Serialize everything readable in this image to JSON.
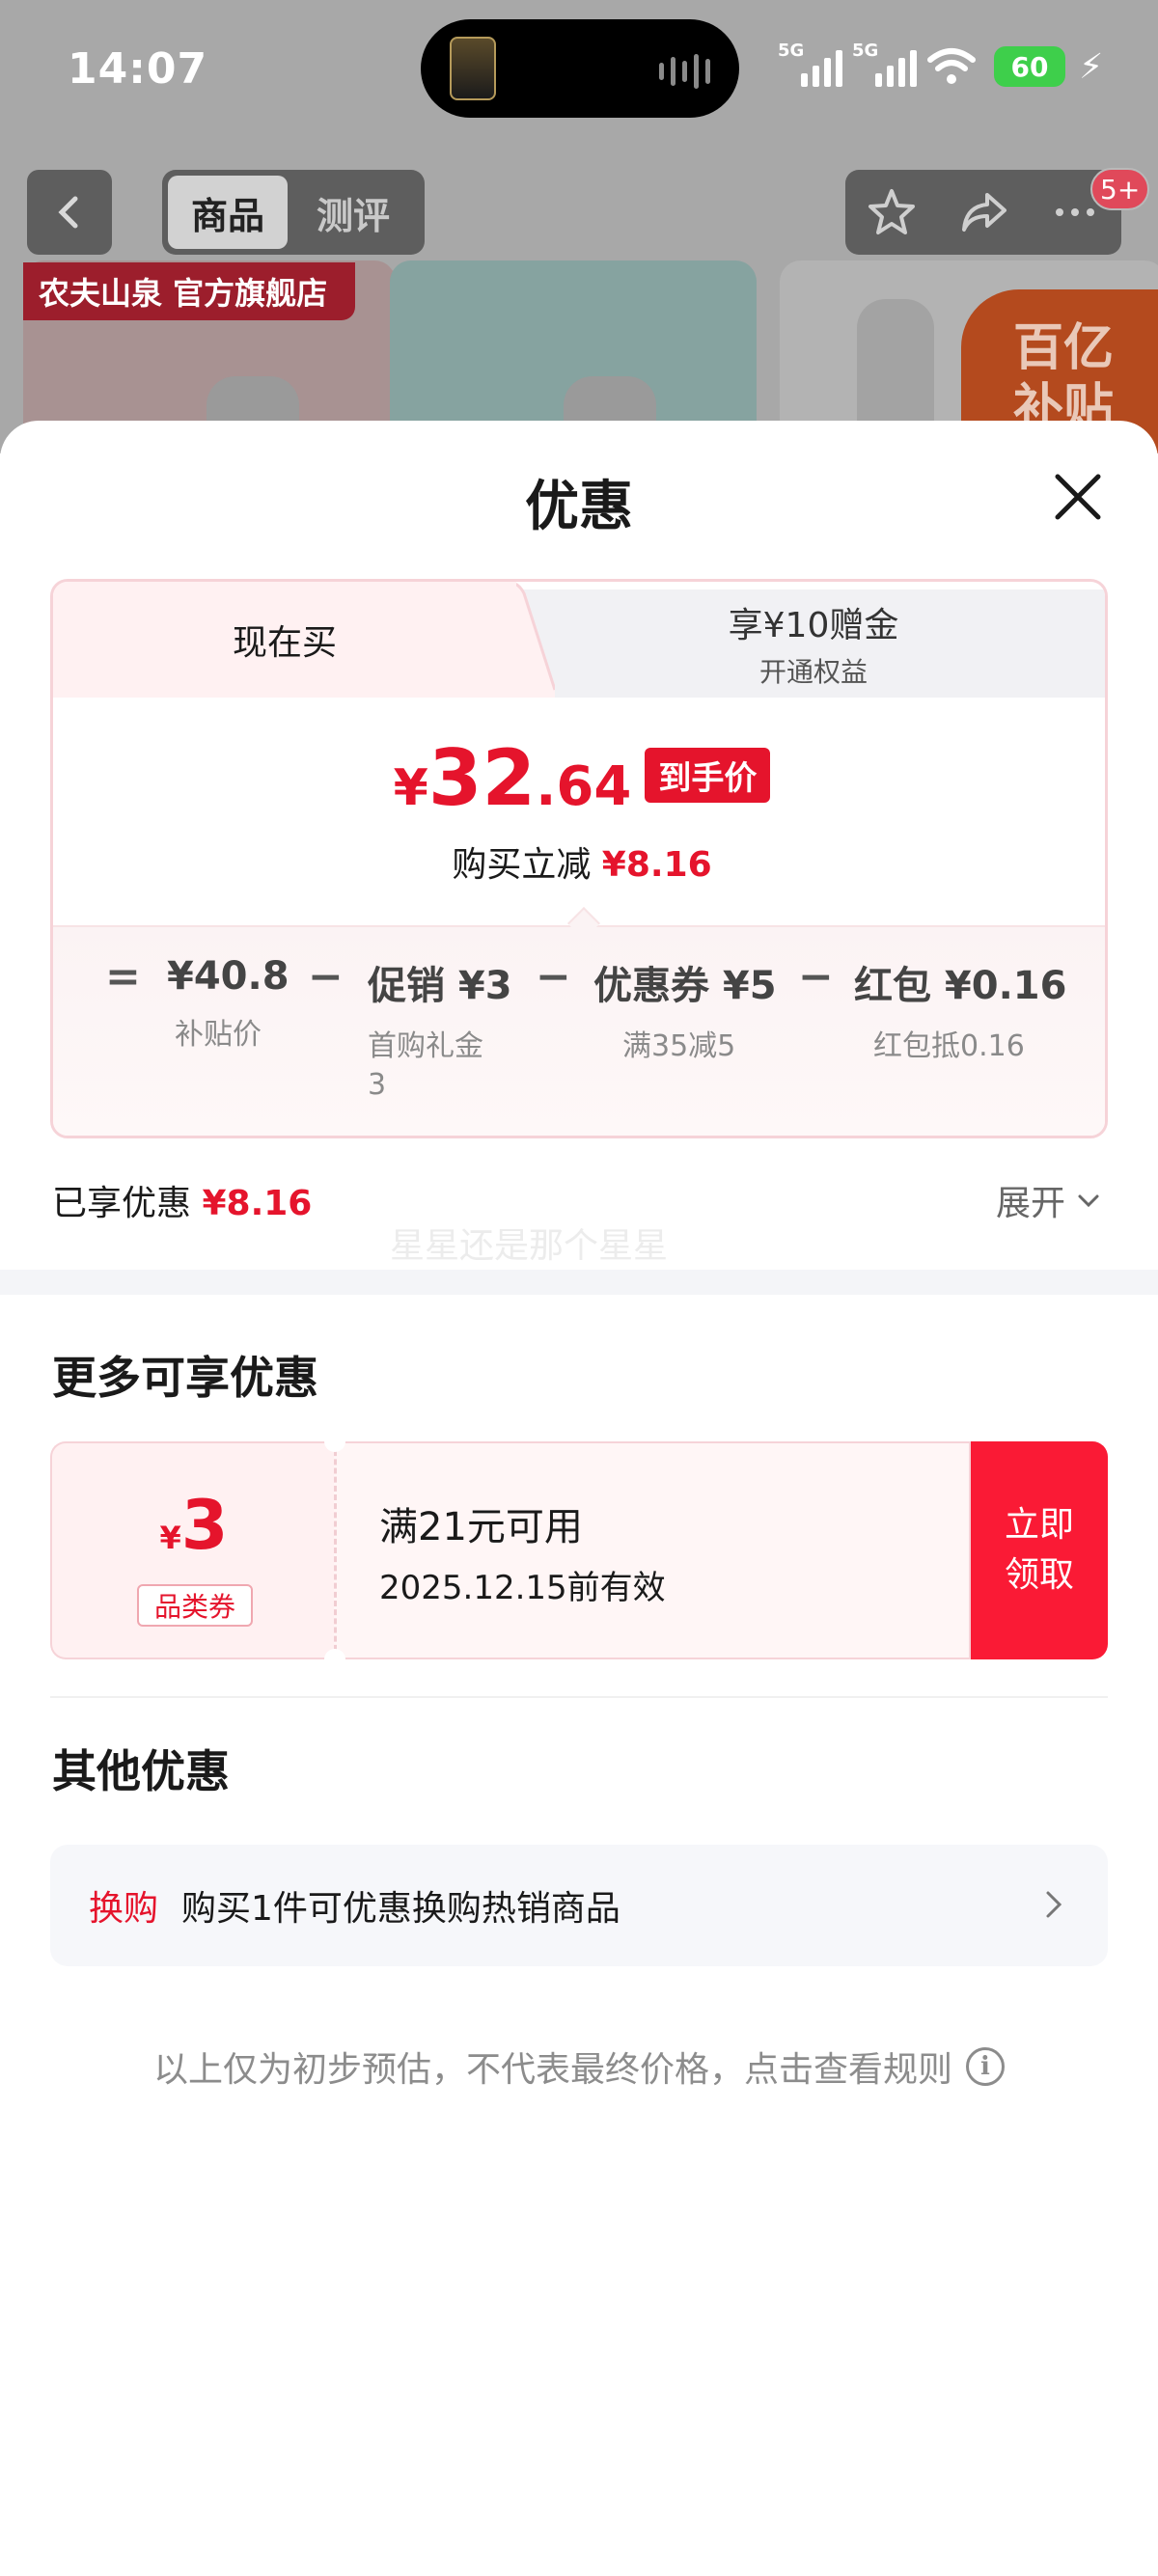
{
  "status_bar": {
    "time": "14:07",
    "signal1_label": "5G",
    "signal2_label": "5G",
    "battery": "60"
  },
  "top_nav": {
    "tabs": [
      {
        "label": "商品",
        "active": true
      },
      {
        "label": "测评",
        "active": false
      }
    ],
    "badge": "5+",
    "store_label": "农夫山泉 官方旗舰店",
    "promo_text": "百亿补贴"
  },
  "sheet": {
    "title": "优惠",
    "tabs": {
      "now": "现在买",
      "vip_line1": "享¥10赠金",
      "vip_line2": "开通权益"
    },
    "price": {
      "currency": "¥",
      "integer": "32",
      "decimal": ".64",
      "tag": "到手价",
      "save_label": "购买立减",
      "save_amount": "¥8.16"
    },
    "breakdown": {
      "equals": "=",
      "items": [
        {
          "value": "¥40.8",
          "label": "补贴价"
        },
        {
          "op": "−",
          "value": "促销 ¥3",
          "label": "首购礼金\n3"
        },
        {
          "op": "−",
          "value": "优惠券 ¥5",
          "label": "满35减5"
        },
        {
          "op": "−",
          "value": "红包 ¥0.16",
          "label": "红包抵0.16"
        }
      ]
    },
    "enjoyed_label": "已享优惠",
    "enjoyed_amount": "¥8.16",
    "expand_label": "展开",
    "watermark": "星星还是那个星星"
  },
  "more_offers": {
    "title": "更多可享优惠",
    "coupon": {
      "currency": "¥",
      "amount": "3",
      "type": "品类券",
      "condition": "满21元可用",
      "expiry": "2025.12.15前有效",
      "button_line1": "立即",
      "button_line2": "领取"
    }
  },
  "other_offers": {
    "title": "其他优惠",
    "item": {
      "tag": "换购",
      "text": "购买1件可优惠换购热销商品"
    }
  },
  "disclaimer": "以上仅为初步预估，不代表最终价格，点击查看规则",
  "colors": {
    "accent_red": "#e5142c",
    "button_red": "#fa1a35",
    "battery_green": "#3ecf4b"
  }
}
